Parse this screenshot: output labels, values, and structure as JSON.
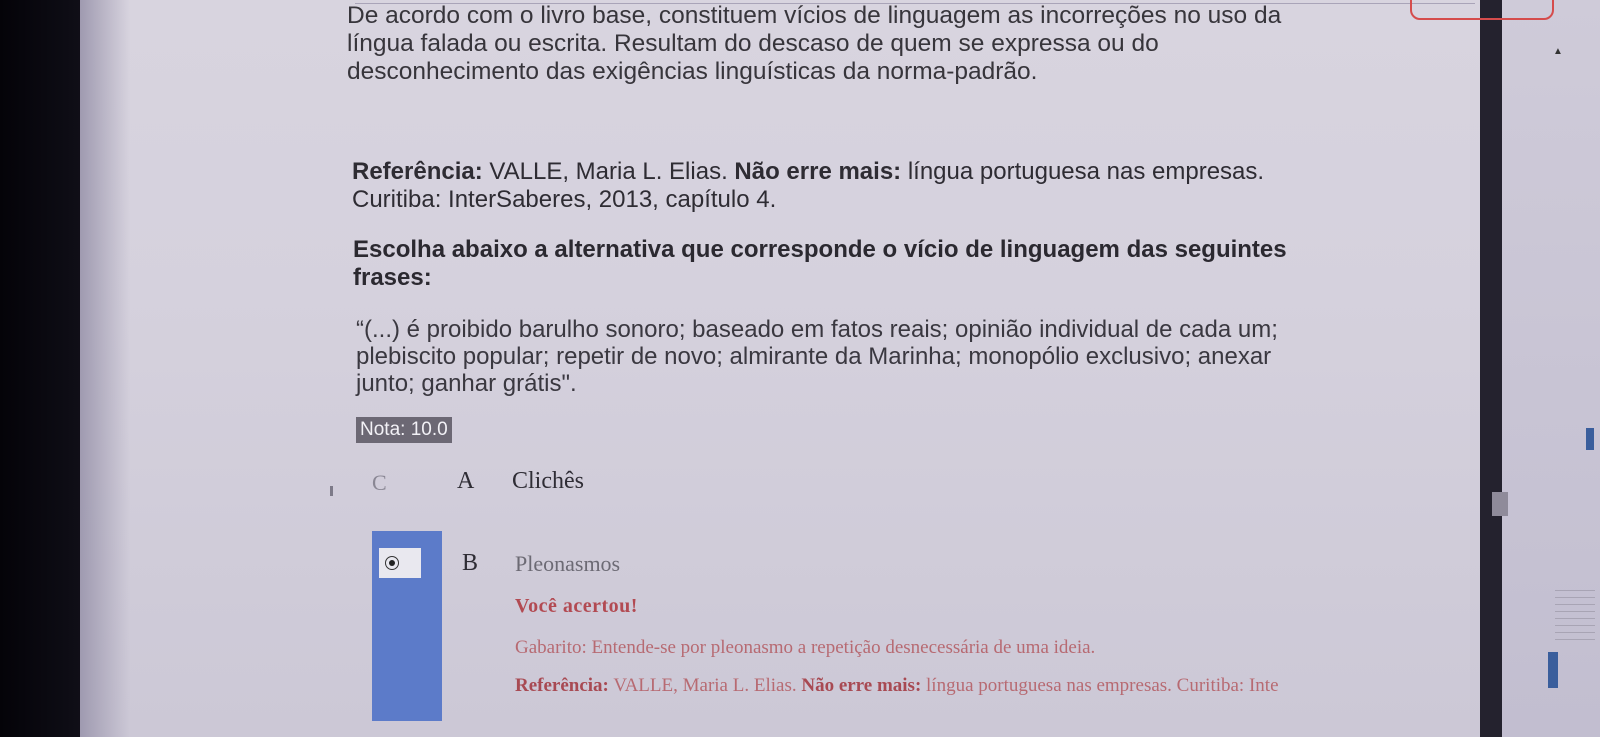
{
  "question": {
    "paragraph1": "De acordo com o livro base, constituem vícios de linguagem as incorreções no uso da língua falada ou escrita. Resultam do descaso de quem se expressa ou do desconhecimento das exigências linguísticas da norma-padrão.",
    "reference": {
      "label": "Referência:",
      "author": "VALLE, Maria L. Elias.",
      "title": "Não erre mais:",
      "subtitle": "língua portuguesa nas empresas.",
      "publication": "Curitiba: InterSaberes, 2013, capítulo 4."
    },
    "prompt": "Escolha abaixo a alternativa que corresponde o vício de linguagem das seguintes frases:",
    "quote": "“(...) é proibido barulho sonoro; baseado em fatos reais; opinião individual de cada um; plebiscito popular; repetir de novo; almirante da Marinha; monopólio exclusivo; anexar junto; ganhar grátis\"."
  },
  "nota": "Nota: 10.0",
  "options": [
    {
      "letter": "A",
      "text": "Clichês",
      "selected": false
    },
    {
      "letter": "B",
      "text": "Pleonasmos",
      "selected": true
    }
  ],
  "feedback": {
    "result": "Você acertou!",
    "gabarito": "Gabarito: Entende-se por pleonasmo a repetição desnecessária de uma ideia.",
    "ref_label": "Referência:",
    "ref_author": "VALLE, Maria L. Elias.",
    "ref_title": "Não erre mais:",
    "ref_rest": "língua portuguesa nas empresas. Curitiba: Inte"
  },
  "colors": {
    "selected_bar": "#5c7bc9",
    "feedback_text": "#b24a52",
    "nota_badge": "#6c6874"
  }
}
